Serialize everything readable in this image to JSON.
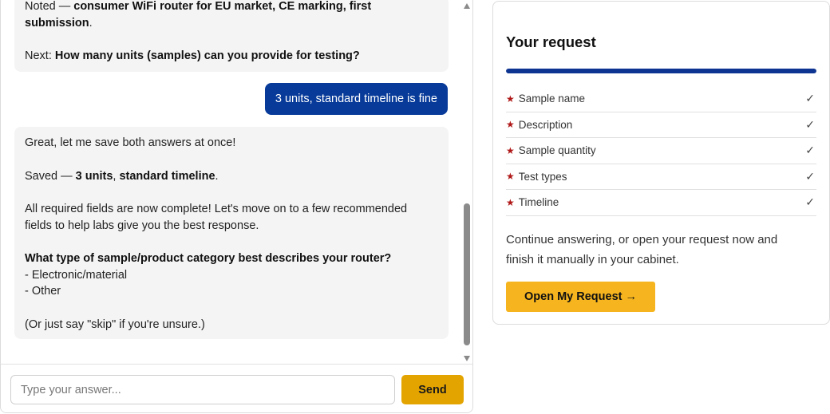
{
  "chat": {
    "messages": [
      {
        "role": "bot",
        "line1_prefix": "Noted — ",
        "line1_bold": "consumer WiFi router for EU market, CE marking, first",
        "line2_bold": "submission",
        "line2_suffix": ".",
        "next_prefix": "Next: ",
        "next_bold": "How many units (samples) can you provide for testing?"
      },
      {
        "role": "user",
        "text": "3 units, standard timeline is fine"
      },
      {
        "role": "bot",
        "line1": "Great, let me save both answers at once!",
        "saved_prefix": "Saved — ",
        "saved_bold_1": "3 units",
        "saved_sep": ", ",
        "saved_bold_2": "standard timeline",
        "saved_suffix": ".",
        "complete_line1": "All required fields are now complete! Let's move on to a few recommended",
        "complete_line2": "fields to help labs give you the best response.",
        "question": "What type of sample/product category best describes your router?",
        "options": [
          "- Electronic/material",
          "- Other"
        ],
        "skip_note": "(Or just say \"skip\" if you're unsure.)"
      }
    ],
    "input_placeholder": "Type your answer...",
    "send_label": "Send"
  },
  "request": {
    "title": "Your request",
    "progress_fraction": 1.0,
    "fields": [
      {
        "label": "Sample name",
        "required_mark": "★",
        "done_mark": "✓"
      },
      {
        "label": "Description",
        "required_mark": "★",
        "done_mark": "✓"
      },
      {
        "label": "Sample quantity",
        "required_mark": "★",
        "done_mark": "✓"
      },
      {
        "label": "Test types",
        "required_mark": "★",
        "done_mark": "✓"
      },
      {
        "label": "Timeline",
        "required_mark": "★",
        "done_mark": "✓"
      }
    ],
    "note": "Continue answering, or open your request now and finish it manually in your cabinet.",
    "open_button_label": "Open My Request →"
  },
  "colors": {
    "user_bubble": "#073a99",
    "bot_bubble": "#f4f4f4",
    "send_button": "#e4a400",
    "open_button": "#f6b51e",
    "progress_fill": "#0d3491",
    "required_star": "#b01818"
  }
}
